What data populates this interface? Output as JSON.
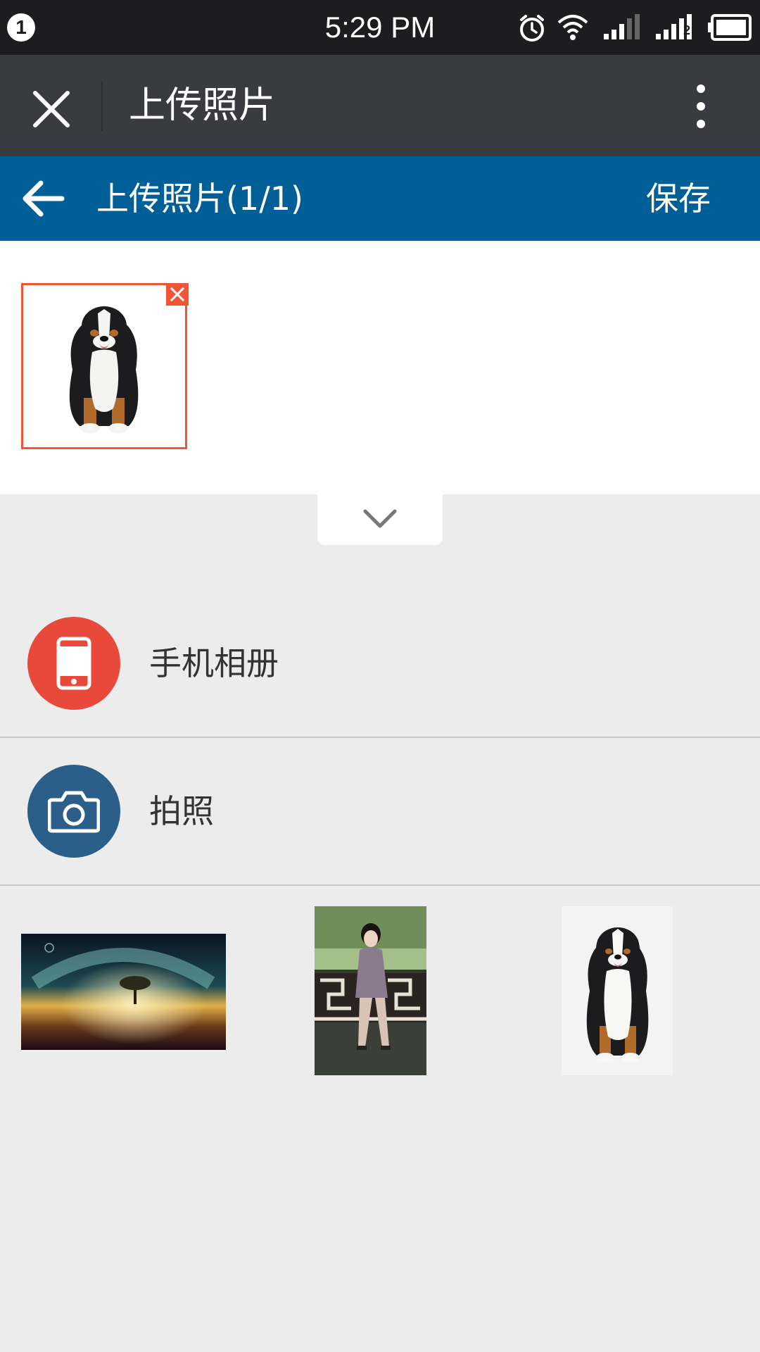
{
  "status_bar": {
    "notification_count": "1",
    "time": "5:29 PM",
    "sim2_label": "2"
  },
  "title_bar": {
    "title": "上传照片"
  },
  "header": {
    "title": "上传照片(1/1)",
    "save_label": "保存"
  },
  "selected": {
    "count": 1,
    "items": [
      {
        "subject": "bernese-mountain-dog"
      }
    ]
  },
  "options": {
    "album_label": "手机相册",
    "camera_label": "拍照"
  },
  "gallery": {
    "items": [
      {
        "subject": "night-sky-landscape"
      },
      {
        "subject": "woman-in-qipao"
      },
      {
        "subject": "bernese-mountain-dog"
      }
    ]
  },
  "colors": {
    "status_bar": "#1d1d1f",
    "title_bar": "#3a3b40",
    "header": "#005f96",
    "accent_remove": "#f05537",
    "album_icon": "#e8493a",
    "camera_icon": "#2b5e88",
    "background": "#ececec"
  }
}
